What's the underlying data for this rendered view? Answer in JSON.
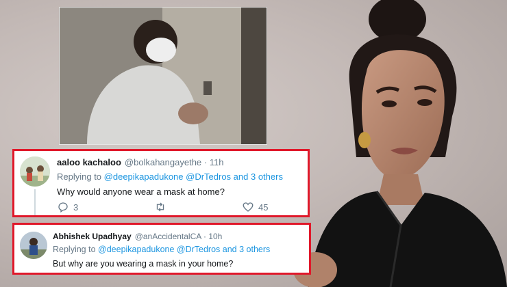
{
  "tweets": [
    {
      "display_name": "aaloo kachaloo",
      "handle": "@bolkahangayethe",
      "time": "· 11h",
      "replying_prefix": "Replying to",
      "replying_to": "@deepikapadukone @DrTedros and 3 others",
      "text": "Why would anyone wear a mask at home?",
      "reply_count": "3",
      "like_count": "45"
    },
    {
      "display_name": "Abhishek Upadhyay",
      "handle": "@anAccidentalCA",
      "time": "· 10h",
      "replying_prefix": "Replying to",
      "replying_to": "@deepikapadukone @DrTedros and 3 others",
      "text": "But why are you wearing a mask in your home?"
    }
  ],
  "icons": {
    "reply": "reply-icon",
    "retweet": "retweet-icon",
    "like": "heart-icon"
  },
  "colors": {
    "highlight_border": "#e0182a",
    "mention": "#1b95e0",
    "muted": "#657786"
  }
}
